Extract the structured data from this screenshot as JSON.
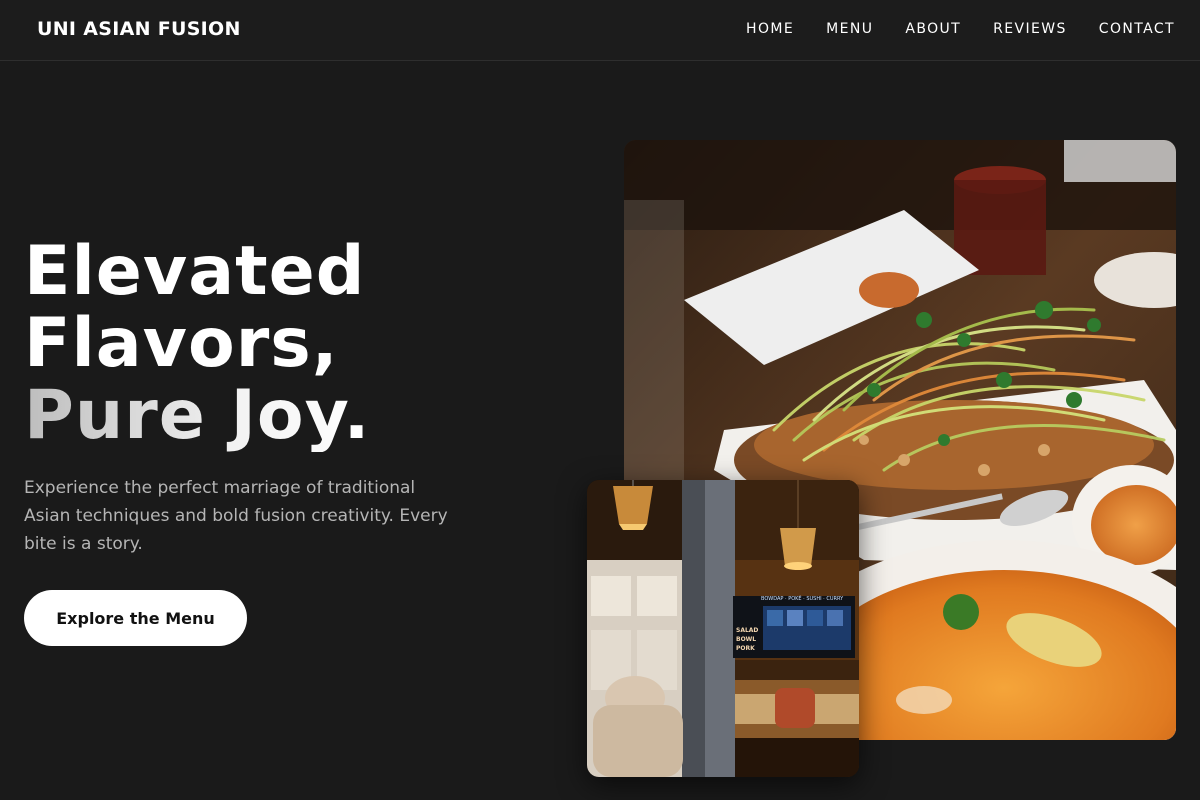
{
  "nav": {
    "brand": "UNI ASIAN FUSION",
    "links": [
      "HOME",
      "MENU",
      "ABOUT",
      "REVIEWS",
      "CONTACT"
    ]
  },
  "hero": {
    "title_line1": "Elevated",
    "title_line2": "Flavors,",
    "title_line3": "Pure Joy.",
    "subtitle": "Experience the perfect marriage of traditional Asian techniques and bold fusion creativity. Every bite is a story.",
    "cta_label": "Explore the Menu"
  },
  "photos": {
    "interior_board_head": "BOWDAP · POKÉ · SUSHI · CURRY",
    "interior_board_items": [
      "SALAD",
      "BOWL",
      "PORK"
    ]
  },
  "colors": {
    "background": "#1a1a1a",
    "text": "#ffffff",
    "subtitle": "#b5b5b5",
    "cta_bg": "#ffffff",
    "cta_text": "#111111"
  }
}
